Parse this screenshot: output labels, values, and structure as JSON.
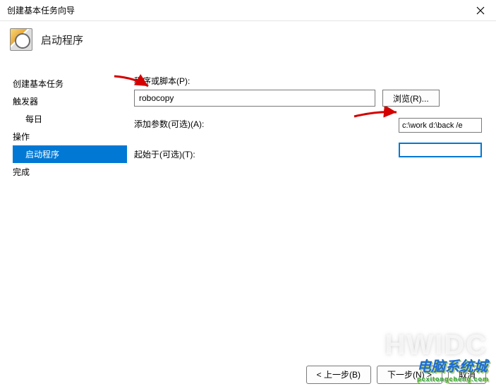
{
  "window": {
    "title": "创建基本任务向导"
  },
  "header": {
    "title": "启动程序"
  },
  "sidebar": {
    "items": [
      {
        "label": "创建基本任务"
      },
      {
        "label": "触发器"
      },
      {
        "label": "每日"
      },
      {
        "label": "操作"
      },
      {
        "label": "启动程序"
      },
      {
        "label": "完成"
      }
    ]
  },
  "form": {
    "program_label": "程序或脚本(P):",
    "program_value": "robocopy",
    "browse_label": "浏览(R)...",
    "args_label": "添加参数(可选)(A):",
    "args_value": "c:\\work d:\\back /e",
    "startin_label": "起始于(可选)(T):",
    "startin_value": ""
  },
  "footer": {
    "back": "< 上一步(B)",
    "next": "下一步(N) >",
    "cancel": "取消"
  },
  "watermark": {
    "main": "HWIDC",
    "brand": "电脑系统城",
    "sub": "pcxitongcheng.com"
  }
}
